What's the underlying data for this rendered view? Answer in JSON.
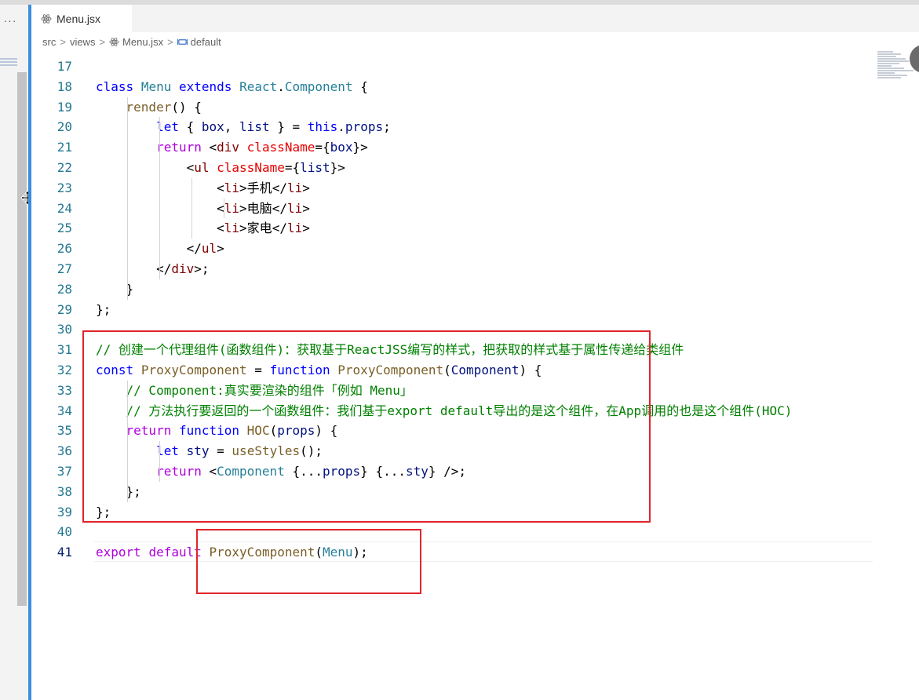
{
  "tab": {
    "label": "Menu.jsx",
    "icon": "react-icon"
  },
  "overflow_menu": {
    "label": "···"
  },
  "breadcrumb": {
    "seg1": "src",
    "seg2": "views",
    "seg3": "Menu.jsx",
    "seg4": "default",
    "sep": ">"
  },
  "colors": {
    "accent": "#3c8ee0",
    "highlight_box": "#e0252b"
  },
  "code": {
    "active_line": "41",
    "lines": [
      {
        "n": "17"
      },
      {
        "n": "18",
        "t": [
          "class",
          " ",
          "Menu",
          " ",
          "extends",
          " ",
          "React",
          ".",
          "Component",
          " {"
        ]
      },
      {
        "n": "19",
        "t": [
          "    ",
          "render",
          "() {"
        ]
      },
      {
        "n": "20",
        "t": [
          "        ",
          "let",
          " { ",
          "box",
          ", ",
          "list",
          " } = ",
          "this",
          ".",
          "props",
          ";"
        ]
      },
      {
        "n": "21",
        "t": [
          "        ",
          "return",
          " <",
          "div",
          " ",
          "className",
          "={",
          "box",
          "}>"
        ]
      },
      {
        "n": "22",
        "t": [
          "            <",
          "ul",
          " ",
          "className",
          "={",
          "list",
          "}>"
        ]
      },
      {
        "n": "23",
        "t": [
          "                <",
          "li",
          ">",
          "手机",
          "</",
          "li",
          ">"
        ]
      },
      {
        "n": "24",
        "t": [
          "                <",
          "li",
          ">",
          "电脑",
          "</",
          "li",
          ">"
        ]
      },
      {
        "n": "25",
        "t": [
          "                <",
          "li",
          ">",
          "家电",
          "</",
          "li",
          ">"
        ]
      },
      {
        "n": "26",
        "t": [
          "            </",
          "ul",
          ">"
        ]
      },
      {
        "n": "27",
        "t": [
          "        </",
          "div",
          ">;"
        ]
      },
      {
        "n": "28",
        "t": [
          "    }"
        ]
      },
      {
        "n": "29",
        "t": [
          "};"
        ]
      },
      {
        "n": "30"
      },
      {
        "n": "31",
        "t": [
          "// 创建一个代理组件(函数组件)：获取基于ReactJSS编写的样式，把获取的样式基于属性传递给类组件"
        ]
      },
      {
        "n": "32",
        "t": [
          "const",
          " ",
          "ProxyComponent",
          " = ",
          "function",
          " ",
          "ProxyComponent",
          "(",
          "Component",
          ") {"
        ]
      },
      {
        "n": "33",
        "t": [
          "    ",
          "// Component:真实要渲染的组件「例如 Menu」"
        ]
      },
      {
        "n": "34",
        "t": [
          "    ",
          "// 方法执行要返回的一个函数组件：我们基于export default导出的是这个组件，在App调用的也是这个组件(HOC)"
        ]
      },
      {
        "n": "35",
        "t": [
          "    ",
          "return",
          " ",
          "function",
          " ",
          "HOC",
          "(",
          "props",
          ") {"
        ]
      },
      {
        "n": "36",
        "t": [
          "        ",
          "let",
          " ",
          "sty",
          " = ",
          "useStyles",
          "();"
        ]
      },
      {
        "n": "37",
        "t": [
          "        ",
          "return",
          " <",
          "Component",
          " {...",
          "props",
          "} {...",
          "sty",
          "} />;"
        ]
      },
      {
        "n": "38",
        "t": [
          "    };"
        ]
      },
      {
        "n": "39",
        "t": [
          "};"
        ]
      },
      {
        "n": "40"
      },
      {
        "n": "41",
        "t": [
          "export",
          " ",
          "default",
          " ",
          "ProxyComponent",
          "(",
          "Menu",
          ");"
        ]
      }
    ]
  }
}
